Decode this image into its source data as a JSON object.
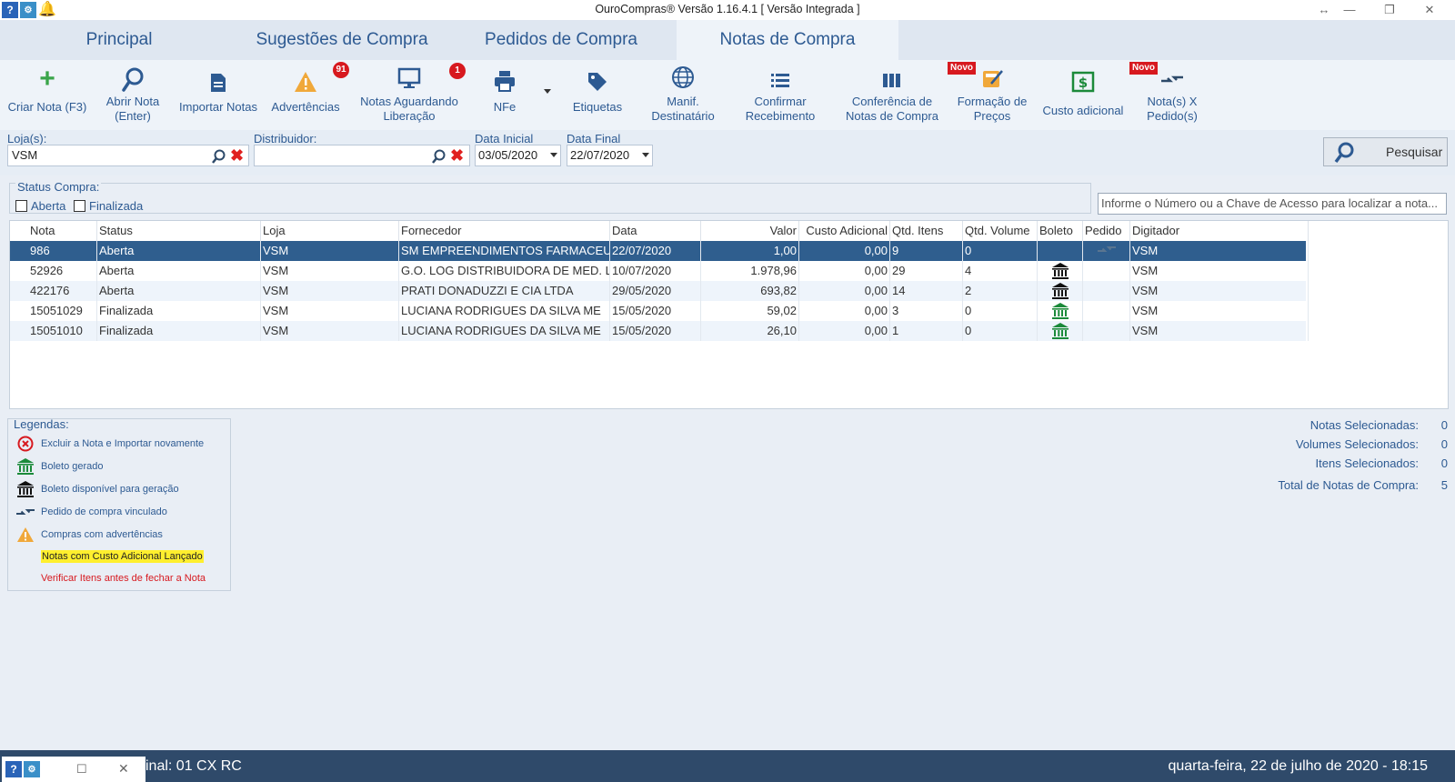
{
  "app": {
    "title": "OuroCompras® Versão 1.16.4.1 [ Versão Integrada ]"
  },
  "tabs": [
    {
      "label": "Principal"
    },
    {
      "label": "Sugestões de Compra"
    },
    {
      "label": "Pedidos de Compra"
    },
    {
      "label": "Notas de Compra"
    }
  ],
  "toolbar": {
    "criar_nota": {
      "line1": "Criar Nota (F3)"
    },
    "abrir_nota": {
      "line1": "Abrir Nota",
      "line2": "(Enter)"
    },
    "importar": {
      "line1": "Importar Notas"
    },
    "advertencias": {
      "line1": "Advertências",
      "badge": "91"
    },
    "aguardando": {
      "line1": "Notas Aguardando",
      "line2": "Liberação",
      "badge": "1"
    },
    "nfe": {
      "line1": "NFe"
    },
    "etiquetas": {
      "line1": "Etiquetas"
    },
    "manif": {
      "line1": "Manif.",
      "line2": "Destinatário"
    },
    "confirmar": {
      "line1": "Confirmar",
      "line2": "Recebimento"
    },
    "conferencia": {
      "line1": "Conferência de",
      "line2": "Notas de Compra"
    },
    "formacao": {
      "line1": "Formação de",
      "line2": "Preços",
      "tag": "Novo"
    },
    "custo": {
      "line1": "Custo adicional"
    },
    "notas_pedidos": {
      "line1": "Nota(s) X",
      "line2": "Pedido(s)",
      "tag": "Novo"
    }
  },
  "filters": {
    "loja_label": "Loja(s):",
    "loja_value": "VSM",
    "distribuidor_label": "Distribuidor:",
    "distribuidor_value": "",
    "data_inicial_label": "Data Inicial",
    "data_inicial_value": "03/05/2020",
    "data_final_label": "Data Final",
    "data_final_value": "22/07/2020",
    "search_button": "Pesquisar"
  },
  "status_compra": {
    "label": "Status Compra:",
    "aberta": "Aberta",
    "finalizada": "Finalizada"
  },
  "key_search": {
    "placeholder": "Informe o Número ou a Chave de Acesso para localizar a nota..."
  },
  "grid": {
    "columns": [
      "Nota",
      "Status",
      "Loja",
      "Fornecedor",
      "Data",
      "Valor",
      "Custo Adicional",
      "Qtd. Itens",
      "Qtd. Volume",
      "Boleto",
      "Pedido",
      "Digitador"
    ],
    "rows": [
      {
        "nota": "986",
        "status": "Aberta",
        "loja": "VSM",
        "fornecedor": "SM EMPREENDIMENTOS FARMACEUTI",
        "data": "22/07/2020",
        "valor": "1,00",
        "custo": "0,00",
        "itens": "9",
        "volume": "0",
        "boleto": "",
        "pedido": "linked-icon",
        "digitador": "VSM"
      },
      {
        "nota": "52926",
        "status": "Aberta",
        "loja": "VSM",
        "fornecedor": "G.O. LOG DISTRIBUIDORA DE MED. LTD",
        "data": "10/07/2020",
        "valor": "1.978,96",
        "custo": "0,00",
        "itens": "29",
        "volume": "4",
        "boleto": "bank-black-icon",
        "pedido": "",
        "digitador": "VSM"
      },
      {
        "nota": "422176",
        "status": "Aberta",
        "loja": "VSM",
        "fornecedor": "PRATI DONADUZZI E CIA LTDA",
        "data": "29/05/2020",
        "valor": "693,82",
        "custo": "0,00",
        "itens": "14",
        "volume": "2",
        "boleto": "bank-black-icon",
        "pedido": "",
        "digitador": "VSM"
      },
      {
        "nota": "15051029",
        "status": "Finalizada",
        "loja": "VSM",
        "fornecedor": "LUCIANA RODRIGUES DA SILVA ME",
        "data": "15/05/2020",
        "valor": "59,02",
        "custo": "0,00",
        "itens": "3",
        "volume": "0",
        "boleto": "bank-green-icon",
        "pedido": "",
        "digitador": "VSM"
      },
      {
        "nota": "15051010",
        "status": "Finalizada",
        "loja": "VSM",
        "fornecedor": "LUCIANA RODRIGUES DA SILVA ME",
        "data": "15/05/2020",
        "valor": "26,10",
        "custo": "0,00",
        "itens": "1",
        "volume": "0",
        "boleto": "bank-green-icon",
        "pedido": "",
        "digitador": "VSM"
      }
    ]
  },
  "legends": {
    "title": "Legendas:",
    "items": [
      {
        "text": "Excluir a Nota e Importar novamente",
        "icon": "x-circle-icon"
      },
      {
        "text": "Boleto gerado",
        "icon": "bank-green-icon"
      },
      {
        "text": "Boleto disponível para geração",
        "icon": "bank-black-icon"
      },
      {
        "text": "Pedido de compra vinculado",
        "icon": "linked-icon"
      },
      {
        "text": "Compras com advertências",
        "icon": "warning-icon"
      },
      {
        "text": "Notas com Custo Adicional Lançado",
        "icon": ""
      },
      {
        "text": "Verificar Itens antes de fechar a Nota",
        "icon": ""
      }
    ]
  },
  "summary": {
    "notas_label": "Notas Selecionadas:",
    "notas_value": "0",
    "volumes_label": "Volumes Selecionados:",
    "volumes_value": "0",
    "itens_label": "Itens Selecionados:",
    "itens_value": "0",
    "total_label": "Total de Notas de Compra:",
    "total_value": "5"
  },
  "statusbar": {
    "terminal": "inal: 01 CX RC",
    "datetime": "quarta-feira, 22 de julho de 2020 - 18:15"
  },
  "colors": {
    "accent": "#2d5a92",
    "selected_row": "#2f5e8e",
    "statusbar": "#2f4a6a",
    "badge": "#d7191f",
    "highlight_yellow": "#ffef2e",
    "warning_red": "#d7191f"
  }
}
